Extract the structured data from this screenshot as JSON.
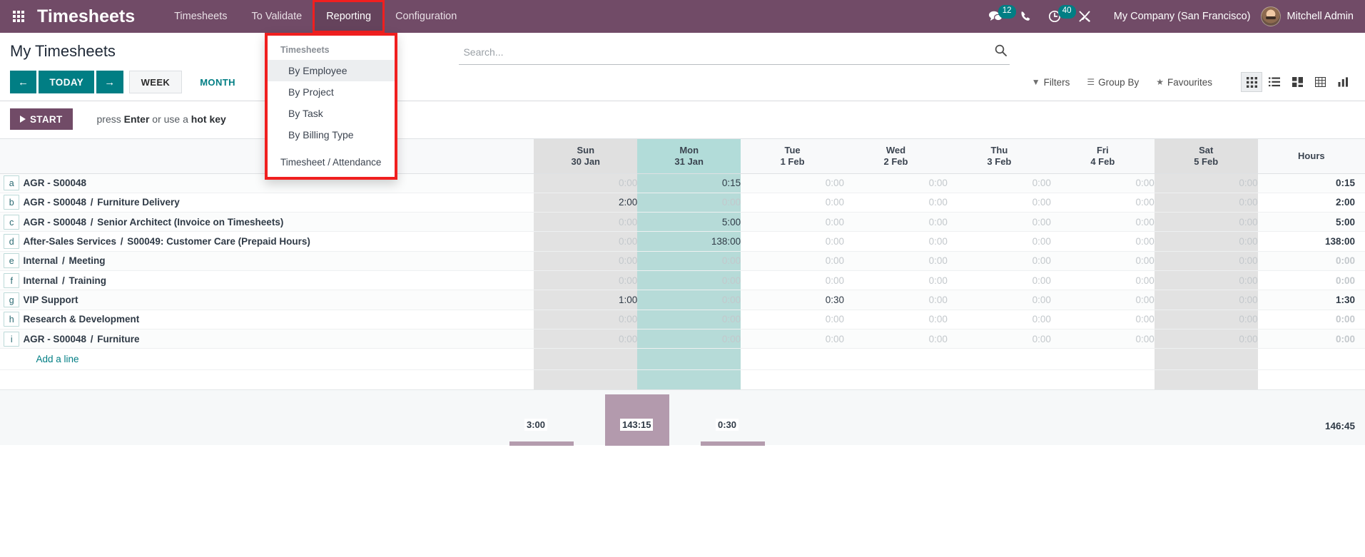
{
  "navbar": {
    "apps_icon": "apps-grid-icon",
    "brand": "Timesheets",
    "menus": [
      {
        "label": "Timesheets",
        "active": false
      },
      {
        "label": "To Validate",
        "active": false
      },
      {
        "label": "Reporting",
        "active": true
      },
      {
        "label": "Configuration",
        "active": false
      }
    ],
    "system_icons": [
      {
        "name": "messages-icon",
        "glyph": "💬",
        "badge": "12"
      },
      {
        "name": "phone-icon",
        "glyph": "📞",
        "badge": ""
      },
      {
        "name": "activities-clock-icon",
        "glyph": "◔",
        "badge": "40"
      },
      {
        "name": "debug-tools-icon",
        "glyph": "⚒",
        "badge": ""
      }
    ],
    "company": "My Company (San Francisco)",
    "user": "Mitchell Admin"
  },
  "dropdown": {
    "name": "reporting-dropdown",
    "section_header": "Timesheets",
    "items": [
      {
        "label": "By Employee",
        "active": true
      },
      {
        "label": "By Project",
        "active": false
      },
      {
        "label": "By Task",
        "active": false
      },
      {
        "label": "By Billing Type",
        "active": false
      }
    ],
    "footer_header": "Timesheet / Attendance"
  },
  "control_panel": {
    "title": "My Timesheets",
    "search": {
      "placeholder": "Search...",
      "value": ""
    },
    "nav": {
      "prev": "←",
      "today": "TODAY",
      "next": "→"
    },
    "scales": [
      {
        "label": "WEEK",
        "active": true
      },
      {
        "label": "MONTH",
        "active": false
      }
    ],
    "tools": [
      {
        "label": "Filters",
        "icon": "filter-icon"
      },
      {
        "label": "Group By",
        "icon": "group-by-icon"
      },
      {
        "label": "Favourites",
        "icon": "star-icon"
      }
    ],
    "views": [
      {
        "name": "grid-view-button",
        "active": true
      },
      {
        "name": "list-view-button",
        "active": false
      },
      {
        "name": "kanban-view-button",
        "active": false
      },
      {
        "name": "pivot-view-button",
        "active": false
      },
      {
        "name": "graph-view-button",
        "active": false
      }
    ]
  },
  "timer": {
    "start_label": "START",
    "hint_prefix": "press ",
    "hint_key1": "Enter",
    "hint_mid": " or use a ",
    "hint_key2": "hot key"
  },
  "grid": {
    "columns": [
      {
        "day": "Sun",
        "date": "30 Jan",
        "style": "weekend"
      },
      {
        "day": "Mon",
        "date": "31 Jan",
        "style": "today"
      },
      {
        "day": "Tue",
        "date": "1 Feb",
        "style": "normal"
      },
      {
        "day": "Wed",
        "date": "2 Feb",
        "style": "normal"
      },
      {
        "day": "Thu",
        "date": "3 Feb",
        "style": "normal"
      },
      {
        "day": "Fri",
        "date": "4 Feb",
        "style": "normal"
      },
      {
        "day": "Sat",
        "date": "5 Feb",
        "style": "weekend"
      }
    ],
    "hours_header": "Hours",
    "add_line_label": "Add a line",
    "rows": [
      {
        "key": "a",
        "project": "AGR - S00048",
        "task": "",
        "values": [
          "0:00",
          "0:15",
          "0:00",
          "0:00",
          "0:00",
          "0:00",
          "0:00"
        ],
        "total": "0:15"
      },
      {
        "key": "b",
        "project": "AGR - S00048",
        "task": "Furniture Delivery",
        "values": [
          "2:00",
          "0:00",
          "0:00",
          "0:00",
          "0:00",
          "0:00",
          "0:00"
        ],
        "total": "2:00"
      },
      {
        "key": "c",
        "project": "AGR - S00048",
        "task": "Senior Architect (Invoice on Timesheets)",
        "values": [
          "0:00",
          "5:00",
          "0:00",
          "0:00",
          "0:00",
          "0:00",
          "0:00"
        ],
        "total": "5:00"
      },
      {
        "key": "d",
        "project": "After-Sales Services",
        "task": "S00049: Customer Care (Prepaid Hours)",
        "values": [
          "0:00",
          "138:00",
          "0:00",
          "0:00",
          "0:00",
          "0:00",
          "0:00"
        ],
        "total": "138:00"
      },
      {
        "key": "e",
        "project": "Internal",
        "task": "Meeting",
        "values": [
          "0:00",
          "0:00",
          "0:00",
          "0:00",
          "0:00",
          "0:00",
          "0:00"
        ],
        "total": "0:00"
      },
      {
        "key": "f",
        "project": "Internal",
        "task": "Training",
        "values": [
          "0:00",
          "0:00",
          "0:00",
          "0:00",
          "0:00",
          "0:00",
          "0:00"
        ],
        "total": "0:00"
      },
      {
        "key": "g",
        "project": "VIP Support",
        "task": "",
        "values": [
          "1:00",
          "0:00",
          "0:30",
          "0:00",
          "0:00",
          "0:00",
          "0:00"
        ],
        "total": "1:30"
      },
      {
        "key": "h",
        "project": "Research & Development",
        "task": "",
        "values": [
          "0:00",
          "0:00",
          "0:00",
          "0:00",
          "0:00",
          "0:00",
          "0:00"
        ],
        "total": "0:00"
      },
      {
        "key": "i",
        "project": "AGR - S00048",
        "task": "Furniture",
        "values": [
          "0:00",
          "0:00",
          "0:00",
          "0:00",
          "0:00",
          "0:00",
          "0:00"
        ],
        "total": "0:00"
      }
    ]
  },
  "chart_data": {
    "type": "bar",
    "title": "",
    "categories": [
      "Sun 30 Jan",
      "Mon 31 Jan",
      "Tue 1 Feb",
      "Wed 2 Feb",
      "Thu 3 Feb",
      "Fri 4 Feb",
      "Sat 5 Feb"
    ],
    "labels": [
      "3:00",
      "143:15",
      "0:30",
      "",
      "",
      "",
      ""
    ],
    "values": [
      3.0,
      143.25,
      0.5,
      0,
      0,
      0,
      0
    ],
    "ylim": [
      0,
      143.25
    ],
    "grid": false,
    "legend": false,
    "grand_total": "146:45",
    "bar_color": "#b49cae"
  }
}
